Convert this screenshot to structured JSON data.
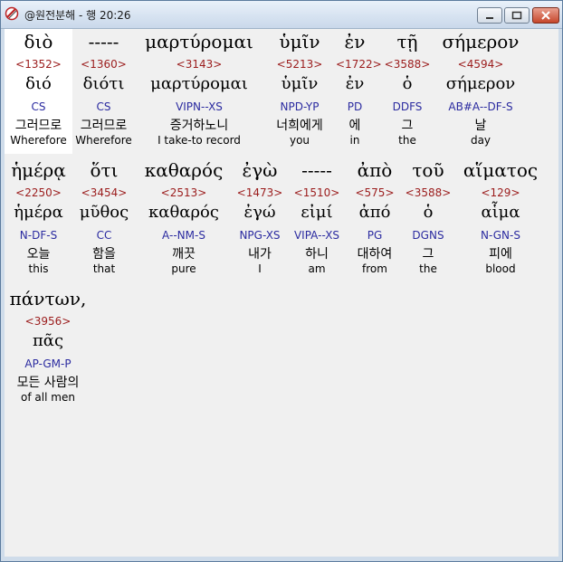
{
  "window": {
    "title": "@원전분해 - 행 20:26"
  },
  "rows": [
    [
      {
        "greek": "διὸ",
        "strong": "<1352>",
        "lemma": "διό",
        "morph": "CS",
        "korean": "그러므로",
        "english": "Wherefore",
        "selected": true
      },
      {
        "greek": "-----",
        "strong": "<1360>",
        "lemma": "διότι",
        "morph": "CS",
        "korean": "그러므로",
        "english": "Wherefore"
      },
      {
        "greek": "μαρτύρομαι",
        "strong": "<3143>",
        "lemma": "μαρτύρομαι",
        "morph": "VIPN--XS",
        "korean": "증거하노니",
        "english": "I take-to record"
      },
      {
        "greek": "ὑμῖν",
        "strong": "<5213>",
        "lemma": "ὑμῖν",
        "morph": "NPD-YP",
        "korean": "너희에게",
        "english": "you"
      },
      {
        "greek": "ἐν",
        "strong": "<1722>",
        "lemma": "ἐν",
        "morph": "PD",
        "korean": "에",
        "english": "in"
      },
      {
        "greek": "τῇ",
        "strong": "<3588>",
        "lemma": "ὁ",
        "morph": "DDFS",
        "korean": "그",
        "english": "the"
      },
      {
        "greek": "σήμερον",
        "strong": "<4594>",
        "lemma": "σήμερον",
        "morph": "AB#A--DF-S",
        "korean": "날",
        "english": "day"
      }
    ],
    [
      {
        "greek": "ἡμέρᾳ",
        "strong": "<2250>",
        "lemma": "ἡμέρα",
        "morph": "N-DF-S",
        "korean": "오늘",
        "english": "this"
      },
      {
        "greek": "ὅτι",
        "strong": "<3454>",
        "lemma": "μῦθος",
        "morph": "CC",
        "korean": "함을",
        "english": "that"
      },
      {
        "greek": "καθαρός",
        "strong": "<2513>",
        "lemma": "καθαρός",
        "morph": "A--NM-S",
        "korean": "깨끗",
        "english": "pure"
      },
      {
        "greek": "ἐγὼ",
        "strong": "<1473>",
        "lemma": "ἐγώ",
        "morph": "NPG-XS",
        "korean": "내가",
        "english": "I"
      },
      {
        "greek": "-----",
        "strong": "<1510>",
        "lemma": "εἰμί",
        "morph": "VIPA--XS",
        "korean": "하니",
        "english": "am"
      },
      {
        "greek": "ἀπὸ",
        "strong": "<575>",
        "lemma": "ἀπό",
        "morph": "PG",
        "korean": "대하여",
        "english": "from"
      },
      {
        "greek": "τοῦ",
        "strong": "<3588>",
        "lemma": "ὁ",
        "morph": "DGNS",
        "korean": "그",
        "english": "the"
      },
      {
        "greek": "αἵματος",
        "strong": "<129>",
        "lemma": "αἷμα",
        "morph": "N-GN-S",
        "korean": "피에",
        "english": "blood"
      }
    ],
    [
      {
        "greek": "πάντων,",
        "strong": "<3956>",
        "lemma": "πᾶς",
        "morph": "AP-GM-P",
        "korean": "모든 사람의",
        "english": "of all men"
      }
    ]
  ]
}
